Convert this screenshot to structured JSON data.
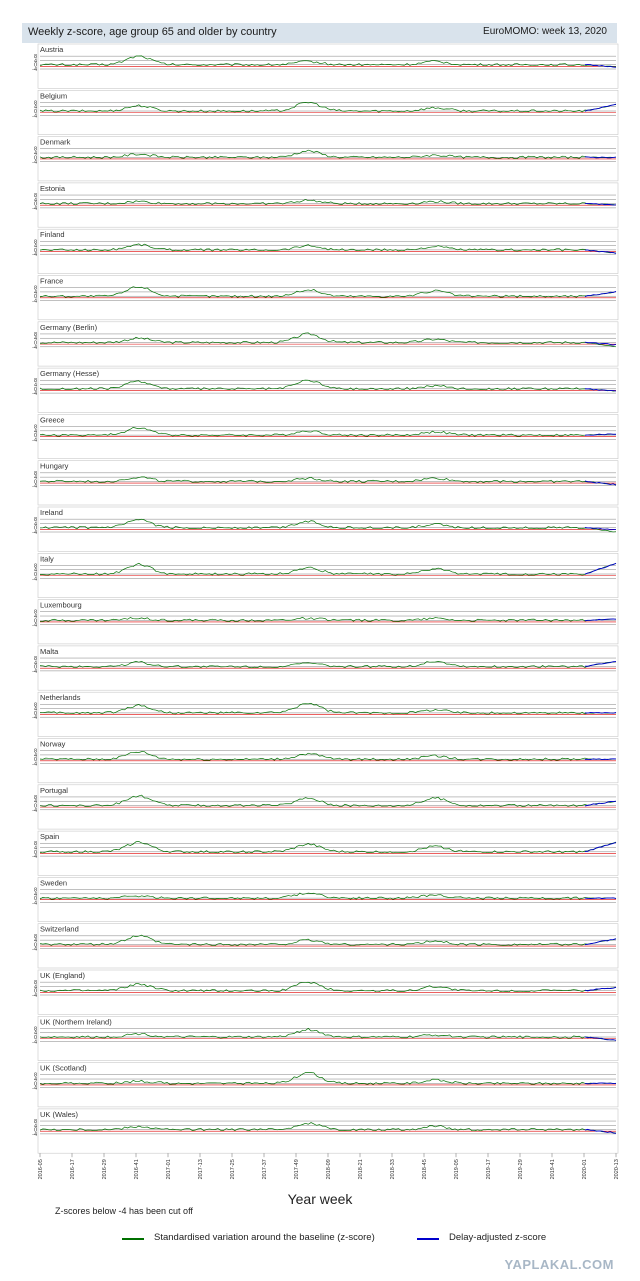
{
  "header": {
    "title": "Weekly z-score, age group 65 and older by country",
    "tag": "EuroMOMO: week 13, 2020"
  },
  "chart_data": {
    "type": "line",
    "panel_labels": [
      "Austria",
      "Belgium",
      "Denmark",
      "Estonia",
      "Finland",
      "France",
      "Germany (Berlin)",
      "Germany (Hesse)",
      "Greece",
      "Hungary",
      "Ireland",
      "Italy",
      "Luxembourg",
      "Malta",
      "Netherlands",
      "Norway",
      "Portugal",
      "Spain",
      "Sweden",
      "Switzerland",
      "UK (England)",
      "UK (Northern Ireland)",
      "UK (Scotland)",
      "UK (Wales)"
    ],
    "y_ticks": [
      "8",
      "4",
      "0",
      "-4"
    ],
    "ylim": [
      -4,
      10
    ],
    "x_ticks": [
      "2016-05",
      "2016-17",
      "2016-29",
      "2016-41",
      "2017-01",
      "2017-13",
      "2017-25",
      "2017-37",
      "2017-49",
      "2018-09",
      "2018-21",
      "2018-33",
      "2018-45",
      "2019-05",
      "2019-17",
      "2019-29",
      "2019-41",
      "2020-01",
      "2020-13"
    ],
    "xlabel": "Year week",
    "note": "Z-scores below -4 has been cut off",
    "legend": [
      {
        "label": "Standardised variation around the baseline (z-score)",
        "color": "#007000"
      },
      {
        "label": "Delay-adjusted z-score",
        "color": "#0000cc"
      }
    ],
    "colors": {
      "zscore": "#007000",
      "delay": "#0000cc",
      "baseline": "#e00000",
      "grid": "#808080"
    },
    "peaks": [
      {
        "country": "Austria",
        "peaks": [
          [
            35,
            8
          ],
          [
            95,
            3
          ],
          [
            140,
            3
          ]
        ],
        "end": -2,
        "delay_end": -2
      },
      {
        "country": "Belgium",
        "peaks": [
          [
            35,
            5
          ],
          [
            95,
            8
          ],
          [
            140,
            3
          ]
        ],
        "end": 6,
        "delay_end": 6
      },
      {
        "country": "Denmark",
        "peaks": [
          [
            35,
            3
          ],
          [
            95,
            6
          ],
          [
            140,
            2
          ]
        ],
        "end": 0,
        "delay_end": 0
      },
      {
        "country": "Estonia",
        "peaks": [
          [
            35,
            2
          ],
          [
            95,
            3
          ],
          [
            140,
            2
          ]
        ],
        "end": -1,
        "delay_end": -1
      },
      {
        "country": "Finland",
        "peaks": [
          [
            35,
            5
          ],
          [
            95,
            4
          ],
          [
            140,
            3
          ]
        ],
        "end": -3,
        "delay_end": -3
      },
      {
        "country": "France",
        "peaks": [
          [
            35,
            9
          ],
          [
            95,
            6
          ],
          [
            140,
            5
          ]
        ],
        "end": 4,
        "delay_end": 4
      },
      {
        "country": "Germany (Berlin)",
        "peaks": [
          [
            35,
            4
          ],
          [
            95,
            8
          ],
          [
            140,
            3
          ]
        ],
        "end": -4,
        "delay_end": -2
      },
      {
        "country": "Germany (Hesse)",
        "peaks": [
          [
            35,
            7
          ],
          [
            95,
            8
          ],
          [
            140,
            3
          ]
        ],
        "end": -2,
        "delay_end": -2
      },
      {
        "country": "Greece",
        "peaks": [
          [
            35,
            7
          ],
          [
            95,
            4
          ],
          [
            140,
            3
          ]
        ],
        "end": 1,
        "delay_end": 1
      },
      {
        "country": "Hungary",
        "peaks": [
          [
            35,
            4
          ],
          [
            95,
            3
          ],
          [
            140,
            3
          ]
        ],
        "end": -3,
        "delay_end": -3
      },
      {
        "country": "Ireland",
        "peaks": [
          [
            35,
            7
          ],
          [
            95,
            6
          ],
          [
            140,
            3
          ]
        ],
        "end": -4,
        "delay_end": -2
      },
      {
        "country": "Italy",
        "peaks": [
          [
            35,
            9
          ],
          [
            95,
            6
          ],
          [
            140,
            5
          ]
        ],
        "end": 10,
        "delay_end": 10
      },
      {
        "country": "Luxembourg",
        "peaks": [
          [
            35,
            2
          ],
          [
            95,
            2
          ],
          [
            140,
            2
          ]
        ],
        "end": 1,
        "delay_end": 1
      },
      {
        "country": "Malta",
        "peaks": [
          [
            35,
            4
          ],
          [
            95,
            3
          ],
          [
            140,
            5
          ]
        ],
        "end": 5,
        "delay_end": 5
      },
      {
        "country": "Netherlands",
        "peaks": [
          [
            35,
            7
          ],
          [
            95,
            9
          ],
          [
            140,
            3
          ]
        ],
        "end": 0,
        "delay_end": 0
      },
      {
        "country": "Norway",
        "peaks": [
          [
            35,
            7
          ],
          [
            95,
            5
          ],
          [
            140,
            3
          ]
        ],
        "end": 0,
        "delay_end": 0
      },
      {
        "country": "Portugal",
        "peaks": [
          [
            35,
            9
          ],
          [
            95,
            7
          ],
          [
            140,
            7
          ]
        ],
        "end": 4,
        "delay_end": 4
      },
      {
        "country": "Spain",
        "peaks": [
          [
            35,
            9
          ],
          [
            95,
            7
          ],
          [
            140,
            5
          ]
        ],
        "end": 9,
        "delay_end": 9
      },
      {
        "country": "Sweden",
        "peaks": [
          [
            35,
            2
          ],
          [
            95,
            5
          ],
          [
            140,
            3
          ]
        ],
        "end": 0,
        "delay_end": 0
      },
      {
        "country": "Switzerland",
        "peaks": [
          [
            35,
            8
          ],
          [
            95,
            4
          ],
          [
            140,
            3
          ]
        ],
        "end": 5,
        "delay_end": 5
      },
      {
        "country": "UK (England)",
        "peaks": [
          [
            35,
            6
          ],
          [
            95,
            8
          ],
          [
            140,
            4
          ]
        ],
        "end": 3,
        "delay_end": 3
      },
      {
        "country": "UK (Northern Ireland)",
        "peaks": [
          [
            35,
            3
          ],
          [
            95,
            7
          ],
          [
            140,
            2
          ]
        ],
        "end": -3,
        "delay_end": -3
      },
      {
        "country": "UK (Scotland)",
        "peaks": [
          [
            35,
            2
          ],
          [
            95,
            10
          ],
          [
            140,
            3
          ]
        ],
        "end": 0,
        "delay_end": 0
      },
      {
        "country": "UK (Wales)",
        "peaks": [
          [
            35,
            3
          ],
          [
            95,
            6
          ],
          [
            140,
            3
          ]
        ],
        "end": -3,
        "delay_end": -3
      }
    ]
  },
  "watermark": "YAPLAKAL.COM"
}
